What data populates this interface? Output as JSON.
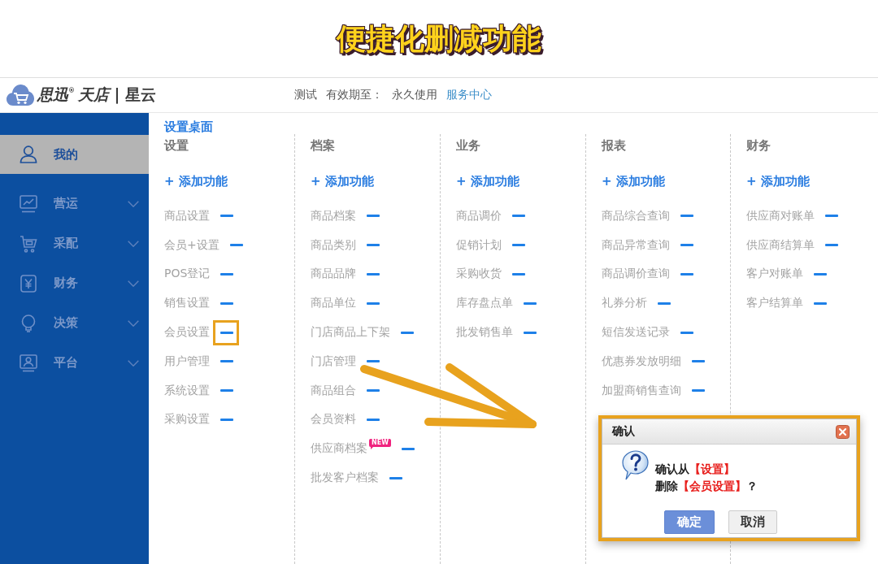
{
  "banner": {
    "title": "便捷化删减功能"
  },
  "header": {
    "logo_text": "*思迅*$^{®}$*天店* | 星云",
    "account": "测试",
    "expiry_label": "有效期至：",
    "expiry_value": "永久使用",
    "service_link": "服务中心"
  },
  "sidebar": {
    "items": [
      {
        "label": "我的",
        "kind": "page",
        "selected": true
      },
      {
        "label": "营运",
        "kind": "group",
        "selected": false
      },
      {
        "label": "采配",
        "kind": "group",
        "selected": false
      },
      {
        "label": "财务",
        "kind": "group",
        "selected": false
      },
      {
        "label": "决策",
        "kind": "group",
        "selected": false
      },
      {
        "label": "平台",
        "kind": "group",
        "selected": false
      }
    ]
  },
  "desktop": {
    "title": "设置桌面",
    "columns": [
      {
        "title": "设置",
        "add_label": "+ 添加功能",
        "items": [
          {
            "label": "商品设置",
            "highlighted": false
          },
          {
            "label": "会员+设置",
            "highlighted": false
          },
          {
            "label": "POS登记",
            "highlighted": false
          },
          {
            "label": "销售设置",
            "highlighted": false
          },
          {
            "label": "会员设置",
            "highlighted": true
          },
          {
            "label": "用户管理",
            "highlighted": false
          },
          {
            "label": "系统设置",
            "highlighted": false
          },
          {
            "label": "采购设置",
            "highlighted": false
          }
        ]
      },
      {
        "title": "档案",
        "add_label": "+ 添加功能",
        "items": [
          {
            "label": "商品档案",
            "highlighted": false
          },
          {
            "label": "商品类别",
            "highlighted": false
          },
          {
            "label": "商品品牌",
            "highlighted": false
          },
          {
            "label": "商品单位",
            "highlighted": false
          },
          {
            "label": "门店商品上下架",
            "highlighted": false
          },
          {
            "label": "门店管理",
            "highlighted": false
          },
          {
            "label": "商品组合",
            "highlighted": false
          },
          {
            "label": "会员资料",
            "highlighted": false
          },
          {
            "label": "供应商档案",
            "badge": "NEW",
            "highlighted": false
          },
          {
            "label": "批发客户档案",
            "highlighted": false
          }
        ]
      },
      {
        "title": "业务",
        "add_label": "+ 添加功能",
        "items": [
          {
            "label": "商品调价",
            "highlighted": false
          },
          {
            "label": "促销计划",
            "highlighted": false
          },
          {
            "label": "采购收货",
            "highlighted": false
          },
          {
            "label": "库存盘点单",
            "highlighted": false
          },
          {
            "label": "批发销售单",
            "highlighted": false
          }
        ]
      },
      {
        "title": "报表",
        "add_label": "+ 添加功能",
        "items": [
          {
            "label": "商品综合查询",
            "highlighted": false
          },
          {
            "label": "商品异常查询",
            "highlighted": false
          },
          {
            "label": "商品调价查询",
            "highlighted": false
          },
          {
            "label": "礼券分析",
            "highlighted": false
          },
          {
            "label": "短信发送记录",
            "highlighted": false
          },
          {
            "label": "优惠券发放明细",
            "highlighted": false
          },
          {
            "label": "加盟商销售查询",
            "highlighted": false
          }
        ]
      },
      {
        "title": "财务",
        "add_label": "+ 添加功能",
        "items": [
          {
            "label": "供应商对账单",
            "highlighted": false
          },
          {
            "label": "供应商结算单",
            "highlighted": false
          },
          {
            "label": "客户对账单",
            "highlighted": false
          },
          {
            "label": "客户结算单",
            "highlighted": false
          }
        ]
      }
    ]
  },
  "dialog": {
    "title": "确认",
    "message": [
      [
        {
          "text": "确认从",
          "kind": "plain"
        },
        {
          "text": "【设置】",
          "kind": "emphasis"
        }
      ],
      [
        {
          "text": "删除",
          "kind": "plain"
        },
        {
          "text": "【会员设置】",
          "kind": "emphasis"
        },
        {
          "text": "？",
          "kind": "plain"
        }
      ]
    ],
    "buttons": [
      {
        "label": "确定",
        "kind": "primary"
      },
      {
        "label": "取消",
        "kind": "secondary"
      }
    ]
  }
}
